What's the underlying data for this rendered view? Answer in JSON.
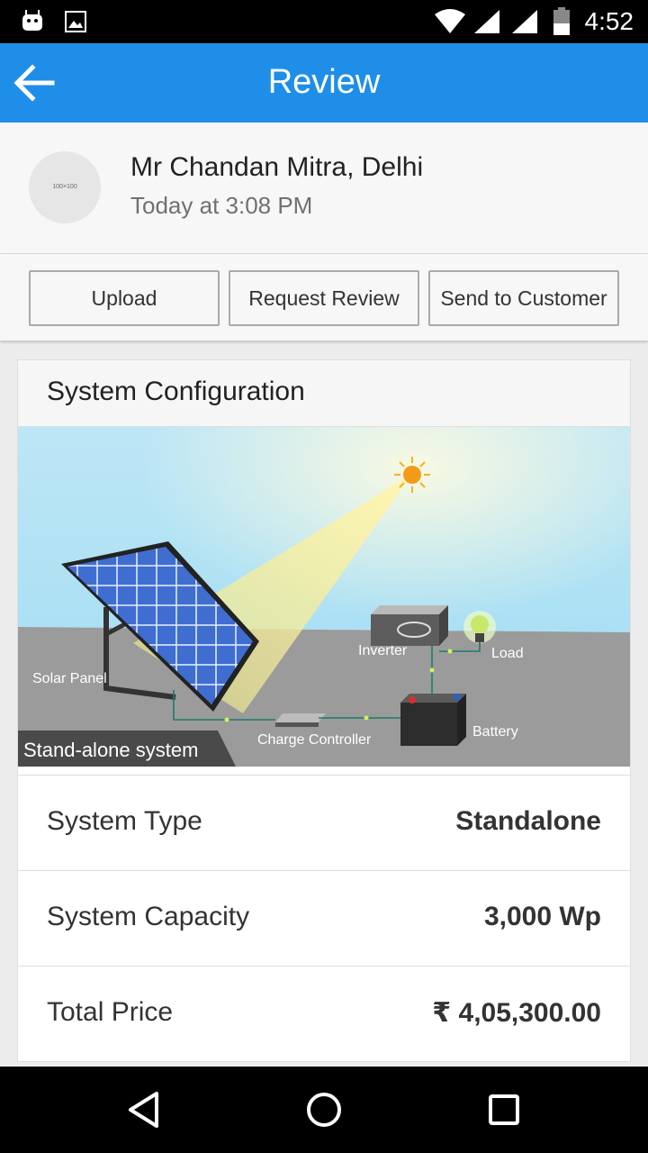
{
  "status_bar": {
    "time": "4:52"
  },
  "app_bar": {
    "title": "Review"
  },
  "profile": {
    "avatar_placeholder": "100×100",
    "name": "Mr Chandan Mitra, Delhi",
    "time": "Today at 3:08 PM"
  },
  "actions": {
    "upload": "Upload",
    "request_review": "Request Review",
    "send_to_customer": "Send to Customer"
  },
  "card": {
    "title": "System Configuration",
    "illustration": {
      "caption": "Stand-alone system",
      "labels": {
        "solar_panel": "Solar Panel",
        "inverter": "Inverter",
        "load": "Load",
        "charge_controller": "Charge Controller",
        "battery": "Battery"
      }
    },
    "rows": [
      {
        "label": "System Type",
        "value": "Standalone"
      },
      {
        "label": "System Capacity",
        "value": "3,000 Wp"
      },
      {
        "label": "Total Price",
        "value": "₹ 4,05,300.00"
      }
    ]
  },
  "icons": {
    "back": "arrow-left-icon",
    "nav_back": "triangle-back-icon",
    "nav_home": "circle-home-icon",
    "nav_recents": "square-recents-icon"
  },
  "colors": {
    "app_bar": "#1e8ee9",
    "status_bar": "#000000"
  }
}
